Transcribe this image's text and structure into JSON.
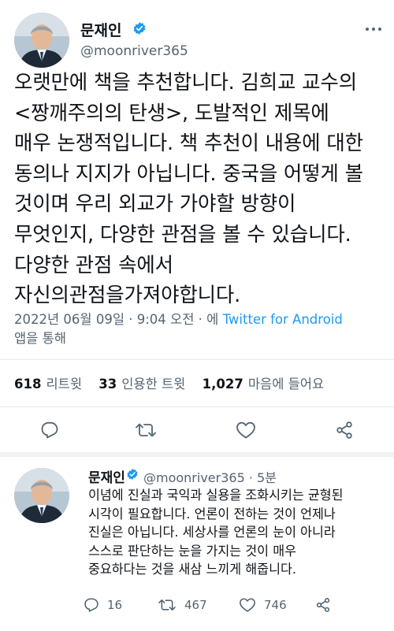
{
  "main_tweet": {
    "author_name": "문재인",
    "author_handle": "@moonriver365",
    "text_lines": [
      "오랫만에 책을 추천합니다. 김희교 교수의",
      "<짱깨주의의 탄생>, 도발적인 제목에",
      "매우 논쟁적입니다. 책 추천이 내용에 대한",
      "동의나 지지가 아닙니다. 중국을 어떻게 볼",
      "것이며 우리 외교가 가야할 방향이",
      "무엇인지, 다양한 관점을 볼 수 있습니다.",
      "다양한 관점 속에서",
      "자신의관점을가져야합니다."
    ],
    "timestamp": "2022년 06월 09일 · 9:04 오전 · 에",
    "source": "Twitter for Android",
    "source_suffix": "앱을 통해",
    "stats": {
      "retweets_count": "618",
      "retweets_label": "리트윗",
      "quotes_count": "33",
      "quotes_label": "인용한 트윗",
      "likes_count": "1,027",
      "likes_label": "마음에 들어요"
    }
  },
  "reply_tweet": {
    "author_name": "문재인",
    "author_handle": "@moonriver365 · 5분",
    "text_lines": [
      "이념에 진실과 국익과 실용을 조화시키는 균형된",
      "시각이 필요합니다. 언론이  전하는 것이 언제나",
      "진실은 아닙니다. 세상사를 언론의 눈이 아니라",
      "스스로 판단하는 눈을 가지는 것이 매우",
      "중요하다는 것을 새삼 느끼게 해줍니다."
    ],
    "reply_count": "16",
    "retweet_count": "467",
    "like_count": "746"
  },
  "icons": {
    "verified": "verified-badge-icon",
    "more": "more-icon",
    "reply": "reply-icon",
    "retweet": "retweet-icon",
    "like": "like-icon",
    "share": "share-icon"
  },
  "colors": {
    "text": "#0f1419",
    "secondary": "#536471",
    "accent": "#1d9bf0",
    "divider": "#e4e7ea"
  }
}
